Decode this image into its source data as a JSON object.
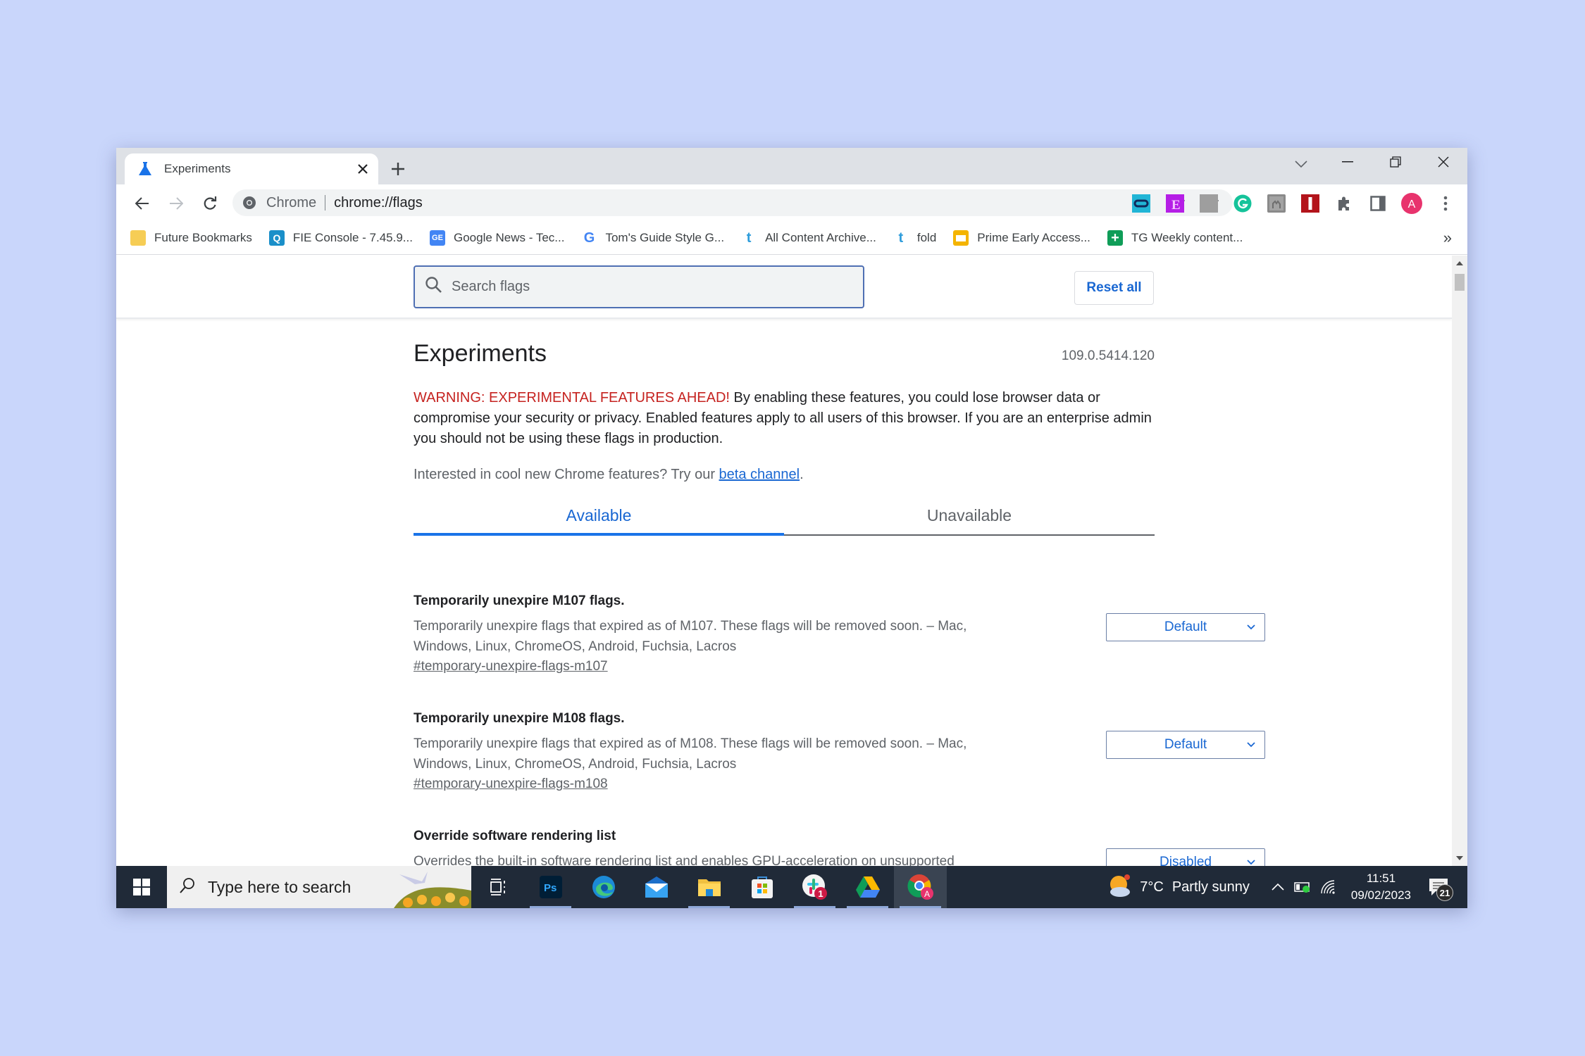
{
  "browser": {
    "tab": {
      "title": "Experiments",
      "icon": "flask-icon"
    },
    "new_tab_label": "+",
    "omnibox": {
      "site_label": "Chrome",
      "url": "chrome://flags"
    },
    "extensions": [
      "link-extension",
      "e-extension",
      "grey-extension",
      "grammarly-extension",
      "camel-extension",
      "red-i-extension",
      "extensions-puzzle",
      "side-panel"
    ],
    "profile_initial": "A",
    "bookmarks": [
      {
        "label": "Future Bookmarks",
        "icon": "folder-icon",
        "color": "#f4c542"
      },
      {
        "label": "FIE Console - 7.45.9...",
        "icon": "fie-icon",
        "color": "#1a8fc9"
      },
      {
        "label": "Google News - Tec...",
        "icon": "google-news-icon",
        "color": "#4285f4"
      },
      {
        "label": "Tom's Guide Style G...",
        "icon": "google-icon",
        "color": "#4285f4"
      },
      {
        "label": "All Content Archive...",
        "icon": "tumblr-t-icon",
        "color": "#2d9cdb"
      },
      {
        "label": "fold",
        "icon": "tumblr-t-icon",
        "color": "#2d9cdb"
      },
      {
        "label": "Prime Early Access...",
        "icon": "slides-icon",
        "color": "#f4b400"
      },
      {
        "label": "TG Weekly content...",
        "icon": "sheets-icon",
        "color": "#0f9d58"
      }
    ],
    "bookmarks_overflow": "»"
  },
  "flags_page": {
    "search_placeholder": "Search flags",
    "reset_all_label": "Reset all",
    "title": "Experiments",
    "version": "109.0.5414.120",
    "warning_prefix": "WARNING: EXPERIMENTAL FEATURES AHEAD!",
    "warning_body": " By enabling these features, you could lose browser data or compromise your security or privacy. Enabled features apply to all users of this browser. If you are an enterprise admin you should not be using these flags in production.",
    "beta_prefix": "Interested in cool new Chrome features? Try our ",
    "beta_link": "beta channel",
    "beta_suffix": ".",
    "tabs": [
      {
        "label": "Available",
        "active": true
      },
      {
        "label": "Unavailable",
        "active": false
      }
    ],
    "flags": [
      {
        "name": "Temporarily unexpire M107 flags.",
        "description": "Temporarily unexpire flags that expired as of M107. These flags will be removed soon. – Mac, Windows, Linux, ChromeOS, Android, Fuchsia, Lacros",
        "link": "#temporary-unexpire-flags-m107",
        "value": "Default"
      },
      {
        "name": "Temporarily unexpire M108 flags.",
        "description": "Temporarily unexpire flags that expired as of M108. These flags will be removed soon. – Mac, Windows, Linux, ChromeOS, Android, Fuchsia, Lacros",
        "link": "#temporary-unexpire-flags-m108",
        "value": "Default"
      },
      {
        "name": "Override software rendering list",
        "description": "Overrides the built-in software rendering list and enables GPU-acceleration on unsupported system configurations. – Mac, Windows, Linux, ChromeOS, Android, Fuchsia, Lacros",
        "link": "",
        "value": "Disabled"
      }
    ]
  },
  "taskbar": {
    "search_placeholder": "Type here to search",
    "apps": [
      {
        "name": "task-view",
        "running": false
      },
      {
        "name": "photoshop",
        "label": "Ps",
        "running": true
      },
      {
        "name": "edge",
        "running": false
      },
      {
        "name": "mail",
        "running": false
      },
      {
        "name": "file-explorer",
        "running": true
      },
      {
        "name": "microsoft-store",
        "running": false
      },
      {
        "name": "slack",
        "badge": "1",
        "running": true
      },
      {
        "name": "google-drive",
        "running": true
      },
      {
        "name": "chrome",
        "badge": "A",
        "running": true,
        "active": true
      }
    ],
    "weather": {
      "temp": "7°C",
      "desc": "Partly sunny"
    },
    "clock": {
      "time": "11:51",
      "date": "09/02/2023"
    },
    "notification_count": "21"
  }
}
